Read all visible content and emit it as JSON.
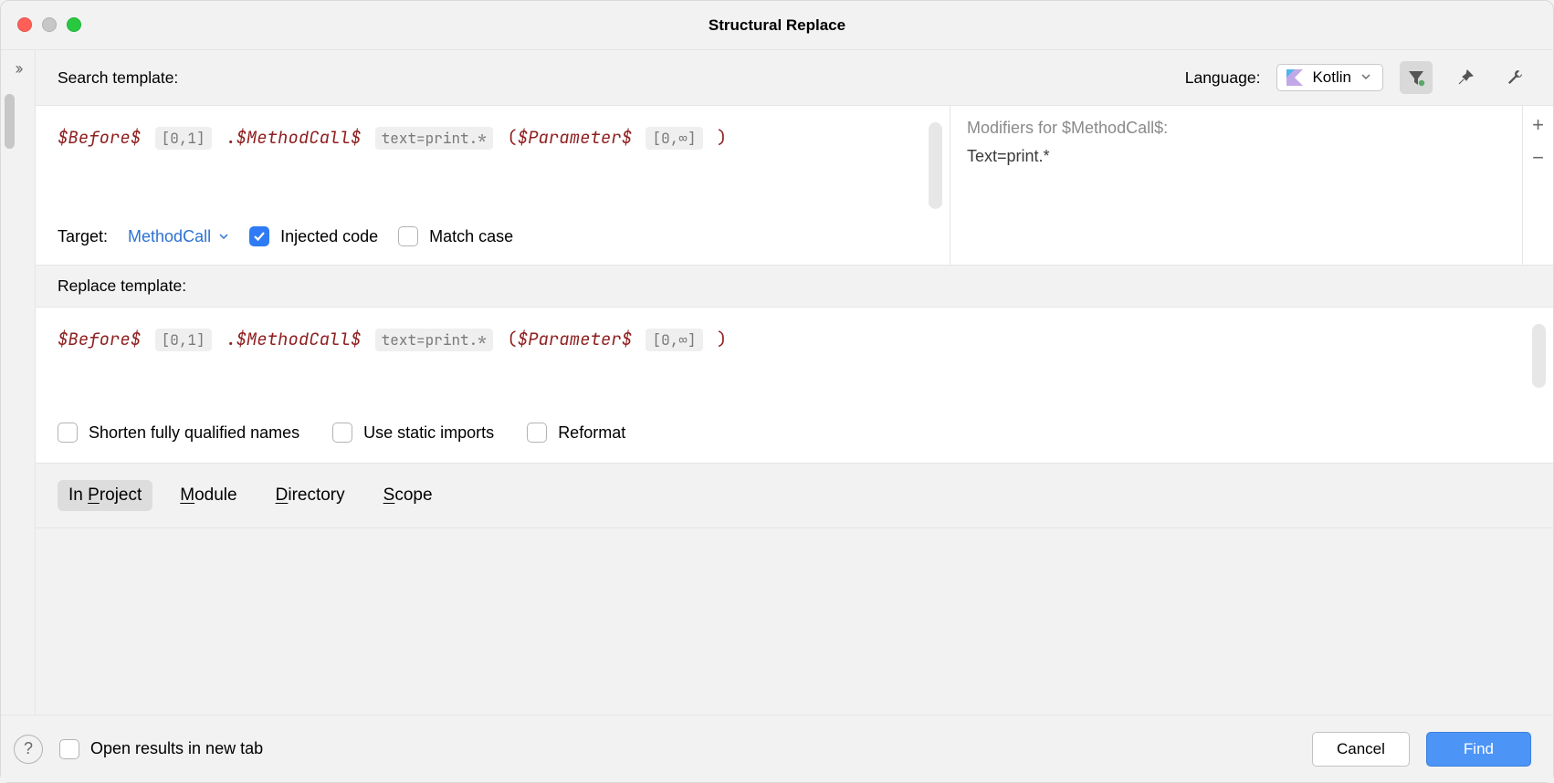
{
  "window": {
    "title": "Structural Replace"
  },
  "search": {
    "label": "Search template:",
    "language_label": "Language:",
    "language_value": "Kotlin",
    "template": {
      "before_var": "$Before$",
      "before_count": "[0,1]",
      "dot": ".",
      "method_var": "$MethodCall$",
      "method_text_hint": "text=print.*",
      "paren_open": "(",
      "param_var": "$Parameter$",
      "param_count": "[0,∞]",
      "paren_close": ")"
    },
    "target_label": "Target:",
    "target_value": "MethodCall",
    "injected_label": "Injected code",
    "injected_checked": true,
    "match_case_label": "Match case",
    "match_case_checked": false
  },
  "modifiers": {
    "title": "Modifiers for $MethodCall$:",
    "lines": [
      "Text=print.*"
    ]
  },
  "replace": {
    "label": "Replace template:",
    "options": {
      "shorten": "Shorten fully qualified names",
      "static_imports": "Use static imports",
      "reformat": "Reformat"
    }
  },
  "scope": {
    "tabs": [
      {
        "label": "In Project",
        "mnemonic_char": "P"
      },
      {
        "label": "Module",
        "mnemonic_char": "M"
      },
      {
        "label": "Directory",
        "mnemonic_char": "D"
      },
      {
        "label": "Scope",
        "mnemonic_char": "S"
      }
    ],
    "active_index": 0
  },
  "footer": {
    "open_in_new_tab": "Open results in new tab",
    "cancel": "Cancel",
    "find": "Find"
  }
}
